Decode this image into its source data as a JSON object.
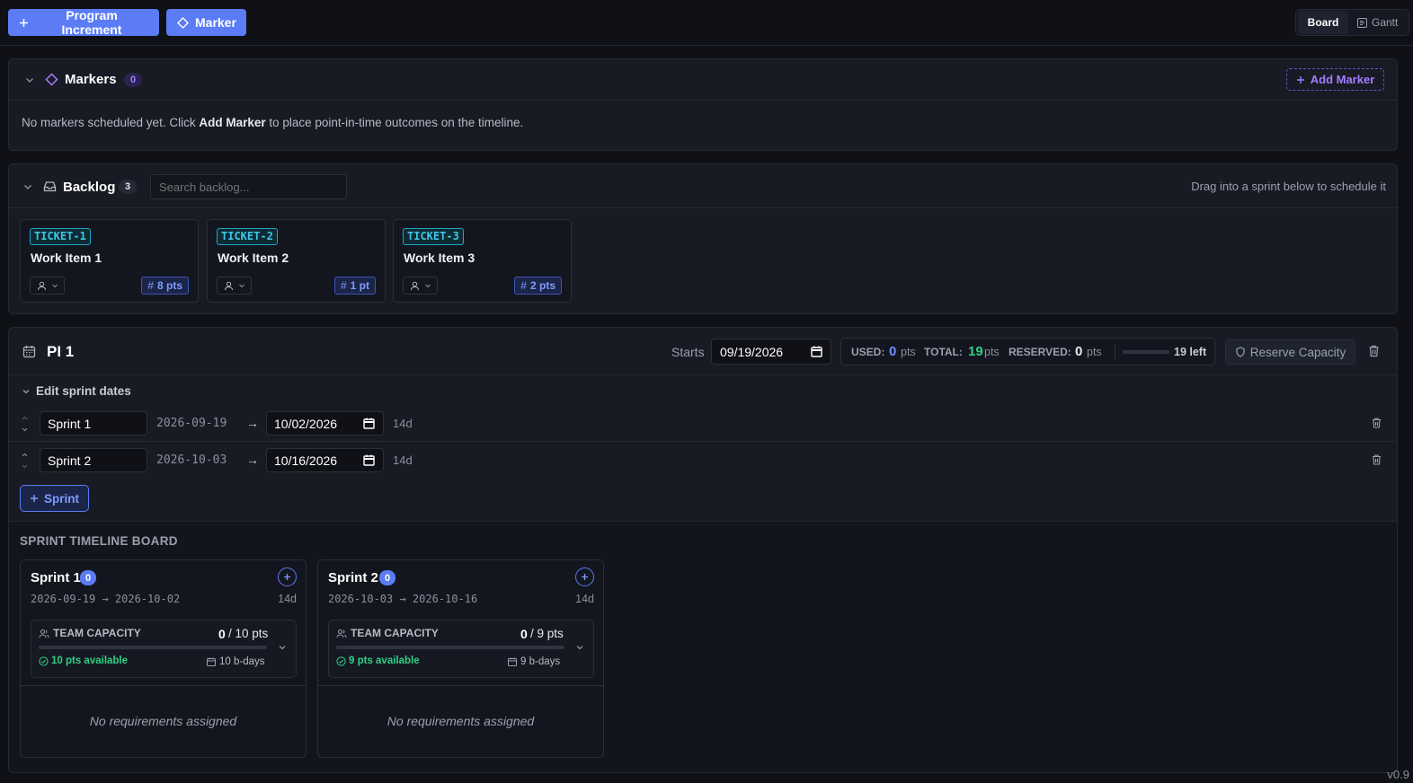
{
  "toolbar": {
    "program_increment_label": "Program Increment",
    "marker_label": "Marker",
    "view_board": "Board",
    "view_gantt": "Gantt"
  },
  "markers": {
    "title": "Markers",
    "count": "0",
    "add_label": "Add Marker",
    "empty_pre": "No markers scheduled yet. Click ",
    "empty_bold": "Add Marker",
    "empty_post": " to place point-in-time outcomes on the timeline."
  },
  "backlog": {
    "title": "Backlog",
    "count": "3",
    "search_placeholder": "Search backlog...",
    "hint": "Drag into a sprint below to schedule it",
    "tickets": [
      {
        "key": "TICKET-1",
        "title": "Work Item 1",
        "points": "8 pts"
      },
      {
        "key": "TICKET-2",
        "title": "Work Item 2",
        "points": "1 pt"
      },
      {
        "key": "TICKET-3",
        "title": "Work Item 3",
        "points": "2 pts"
      }
    ]
  },
  "pi": {
    "title": "PI 1",
    "starts_label": "Starts",
    "start_date": "09/19/2026",
    "used_label": "USED:",
    "used_value": "0",
    "total_label": "TOTAL:",
    "total_value": "19",
    "reserved_label": "RESERVED:",
    "reserved_value": "0",
    "pts_unit": "pts",
    "left": "19 left",
    "used_fraction": 0,
    "reserve_label": "Reserve Capacity",
    "edit_dates_label": "Edit sprint dates",
    "sprints": [
      {
        "name": "Sprint 1",
        "start": "2026-09-19",
        "arrow": "→",
        "end": "10/02/2026",
        "duration": "14d"
      },
      {
        "name": "Sprint 2",
        "start": "2026-10-03",
        "arrow": "→",
        "end": "10/16/2026",
        "duration": "14d"
      }
    ],
    "add_sprint_label": "Sprint"
  },
  "board": {
    "title": "SPRINT TIMELINE BOARD",
    "columns": [
      {
        "name": "Sprint 1",
        "count": "0",
        "range": "2026-09-19 → 2026-10-02",
        "duration": "14d",
        "capacity_label": "TEAM CAPACITY",
        "cap_used": "0",
        "cap_total": "/ 10 pts",
        "cap_fraction": 0,
        "available": "10 pts available",
        "bdays": "10 b-days",
        "empty": "No requirements assigned"
      },
      {
        "name": "Sprint 2",
        "count": "0",
        "range": "2026-10-03 → 2026-10-16",
        "duration": "14d",
        "capacity_label": "TEAM CAPACITY",
        "cap_used": "0",
        "cap_total": "/ 9 pts",
        "cap_fraction": 0,
        "available": "9 pts available",
        "bdays": "9 b-days",
        "empty": "No requirements assigned"
      }
    ]
  },
  "footer": {
    "version": "v0.9"
  },
  "colors": {
    "accent": "#5b7cf5",
    "purple": "#a67cff",
    "green": "#2fcf85",
    "cyan": "#3fc7e6"
  }
}
